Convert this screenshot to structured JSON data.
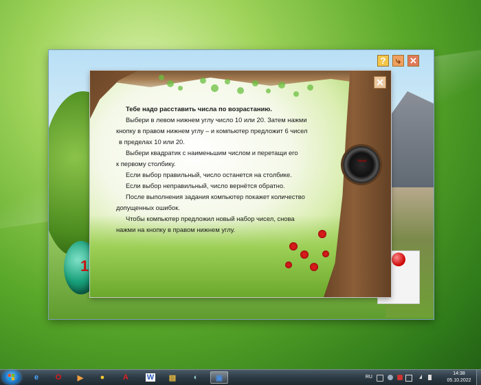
{
  "app": {
    "help_button": "?",
    "home_button": "⤷",
    "close_button": "✕",
    "globe_number": "1"
  },
  "dialog": {
    "close_button": "✕",
    "speaker_brand": "Vestel",
    "lines": {
      "l1": "Тебе надо расставить числа по возрастанию.",
      "l2": "Выбери в левом нижнем углу число 10 или 20. Затем нажми",
      "l3": "кнопку в правом нижнем углу – и компьютер предложит 6 чисел",
      "l4": "в пределах 10 или 20.",
      "l5": "Выбери квадратик с наименьшим числом и перетащи его",
      "l6": "к первому столбику.",
      "l7": "Если выбор правильный, число останется на столбике.",
      "l8": "Если выбор неправильный, число вернётся обратно.",
      "l9": "После выполнения задания компьютер покажет количество",
      "l10": "допущенных ошибок.",
      "l11": "Чтобы компьютер предложил новый набор чисел, снова",
      "l12": "нажми на кнопку в правом нижнем углу."
    }
  },
  "taskbar": {
    "items": [
      {
        "icon": "internet-explorer-icon",
        "glyph": "e"
      },
      {
        "icon": "opera-icon",
        "glyph": "O"
      },
      {
        "icon": "media-player-icon",
        "glyph": "▶"
      },
      {
        "icon": "chrome-icon",
        "glyph": "●"
      },
      {
        "icon": "pdf-reader-icon",
        "glyph": "A"
      },
      {
        "icon": "word-icon",
        "glyph": "W"
      },
      {
        "icon": "file-explorer-icon",
        "glyph": "▤"
      },
      {
        "icon": "browser-icon",
        "glyph": "◐"
      },
      {
        "icon": "app-window-icon",
        "glyph": "▣"
      }
    ],
    "language": "RU",
    "time": "14:38",
    "date": "05.10.2022"
  },
  "colors": {
    "desktop_green": "#5aa82a",
    "taskbar": "#2c3a44",
    "dialog_close": "#e9c7a0",
    "help_button": "#f2c64a",
    "app_close": "#e07a5a"
  }
}
